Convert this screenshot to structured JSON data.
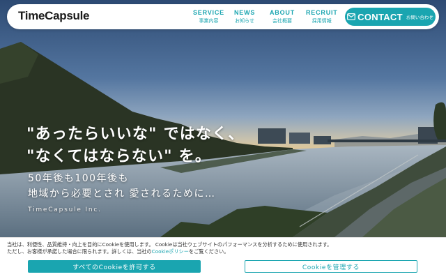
{
  "header": {
    "logo": "TimeCapsule",
    "nav": [
      {
        "en": "SERVICE",
        "ja": "事業内容"
      },
      {
        "en": "NEWS",
        "ja": "お知らせ"
      },
      {
        "en": "ABOUT",
        "ja": "会社概要"
      },
      {
        "en": "RECRUIT",
        "ja": "採用情報"
      }
    ],
    "contact": {
      "en": "CONTACT",
      "ja": "お問い合わせ",
      "icon": "mail-icon"
    }
  },
  "hero": {
    "headline_1": "\"あったらいいな\" ではなく、",
    "headline_2": "\"なくてはならない\" を。",
    "sub_1": "50年後も100年後も",
    "sub_2": "地域から必要とされ 愛されるために…",
    "company": "TimeCapsule Inc."
  },
  "cookie": {
    "line_1": "当社は、利便性、品質維持・向上を目的にCookieを使用します。 Cookieは当社ウェブサイトのパフォーマンスを分析するために使用されます。",
    "line_2_pre": "ただし、お客様が承諾した場合に限られます。詳しくは、当社の",
    "line_2_link": "Cookieポリシー",
    "line_2_post": "をご覧ください。",
    "accept_label": "すべてのCookieを許可する",
    "manage_label": "Cookieを管理する"
  },
  "colors": {
    "accent": "#1aa5b0",
    "header_bg": "#ffffff",
    "text_dark": "#1a1a1a"
  }
}
